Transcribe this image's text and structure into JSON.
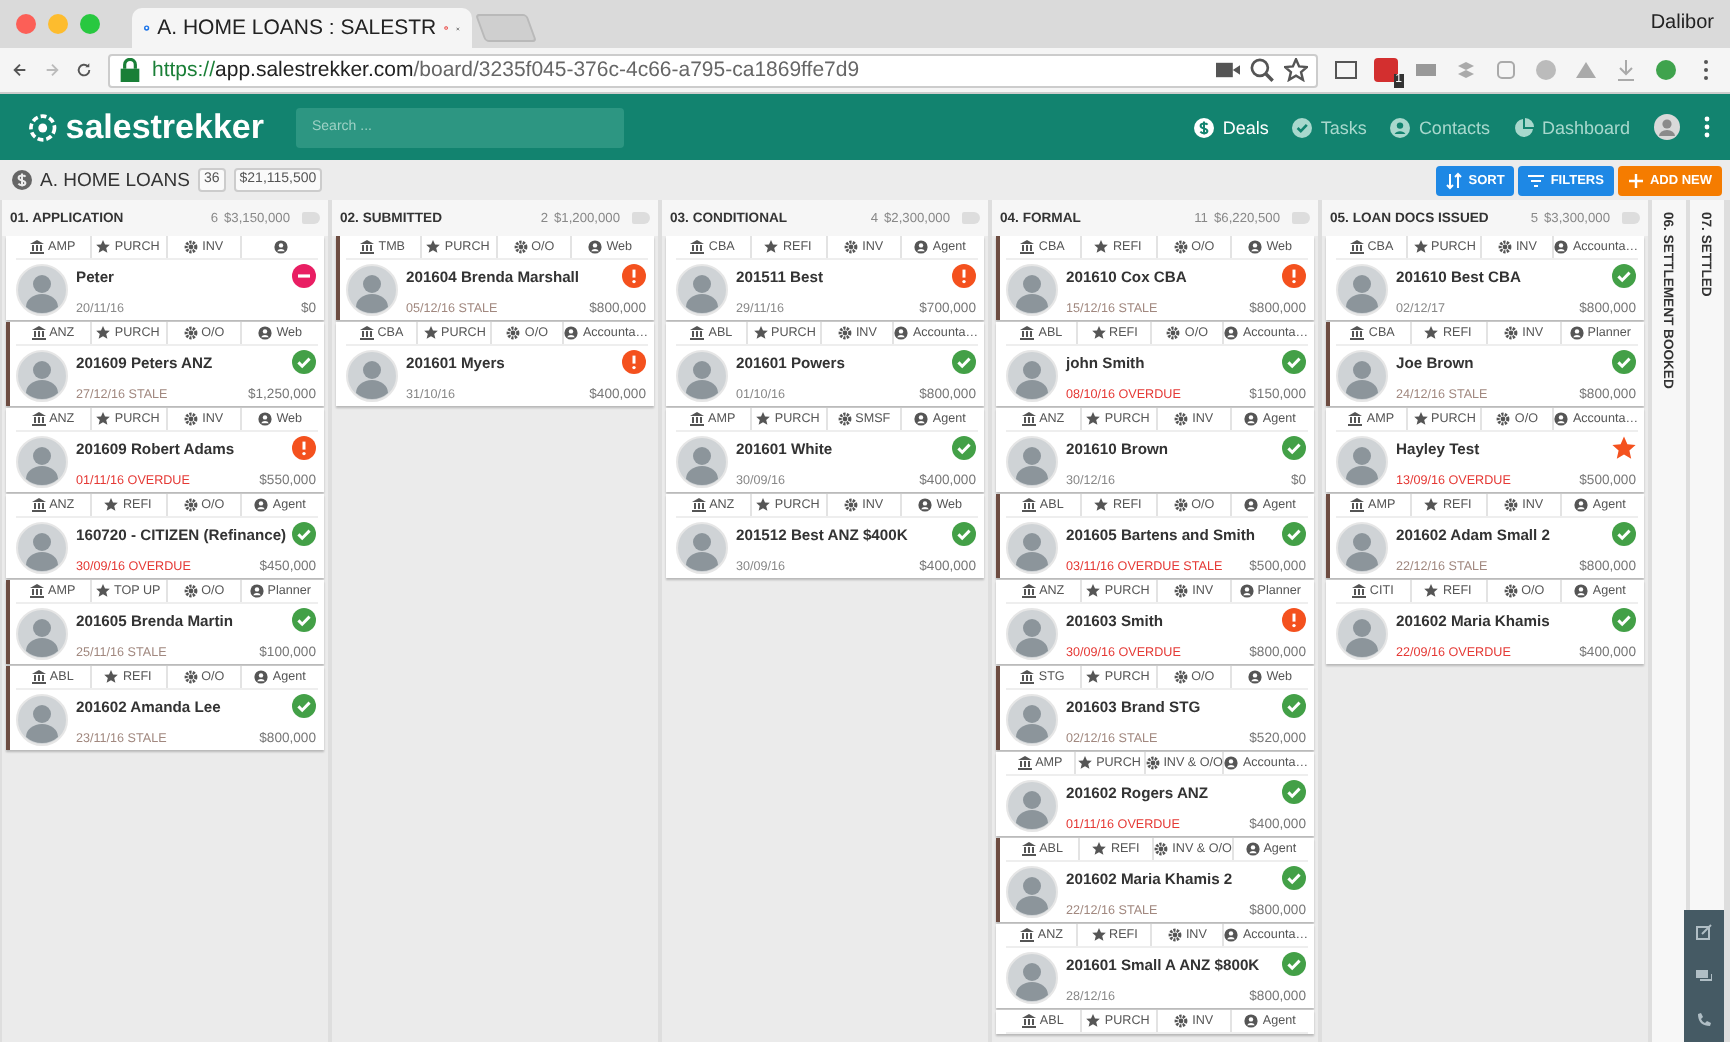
{
  "browser": {
    "tab_title": "A. HOME LOANS : SALESTR",
    "profile": "Dalibor",
    "url": {
      "scheme": "https://",
      "host": "app.salestrekker.com",
      "path": "/board/3235f045-376c-4c66-a795-ca1869ffe7d9"
    },
    "extension_badge": "1"
  },
  "app": {
    "brand": "salestrekker",
    "search": {
      "placeholder": "Search ..."
    },
    "nav": [
      {
        "label": "Deals",
        "kind": "deals",
        "selected": true
      },
      {
        "label": "Tasks",
        "kind": "tasks",
        "selected": false
      },
      {
        "label": "Contacts",
        "kind": "contacts",
        "selected": false
      },
      {
        "label": "Dashboard",
        "kind": "dashboard",
        "selected": false
      }
    ]
  },
  "board": {
    "title": "A. HOME LOANS",
    "count": "36",
    "total": "$21,115,500",
    "buttons": [
      {
        "label": "SORT",
        "kind": "sort"
      },
      {
        "label": "FILTERS",
        "kind": "filter"
      },
      {
        "label": "ADD NEW",
        "kind": "add"
      }
    ]
  },
  "columns": [
    {
      "title": "01. APPLICATION",
      "count": "6",
      "value": "$3,150,000",
      "cards": [
        {
          "tags": {
            "lender": "AMP",
            "type": "PURCH",
            "purpose": "INV"
          },
          "name": "Peter",
          "date": "20/11/16",
          "amount": "$0",
          "kind": "blocked",
          "stale": false,
          "overdue": false
        },
        {
          "tags": {
            "lender": "ANZ",
            "type": "PURCH",
            "purpose": "O/O",
            "source": "Web"
          },
          "name": "201609 Peters ANZ",
          "date": "27/12/16 STALE",
          "amount": "$1,250,000",
          "kind": "done",
          "stale": true,
          "overdue": false
        },
        {
          "tags": {
            "lender": "ANZ",
            "type": "PURCH",
            "purpose": "INV",
            "source": "Web"
          },
          "name": "201609 Robert Adams",
          "date": "01/11/16 OVERDUE",
          "amount": "$550,000",
          "kind": "attention",
          "stale": false,
          "overdue": true
        },
        {
          "tags": {
            "lender": "ANZ",
            "type": "REFI",
            "purpose": "O/O",
            "source": "Agent"
          },
          "name": "160720 - CITIZEN (Refinance)",
          "date": "30/09/16 OVERDUE",
          "amount": "$450,000",
          "kind": "done",
          "stale": false,
          "overdue": true
        },
        {
          "tags": {
            "lender": "AMP",
            "type": "TOP UP",
            "purpose": "O/O",
            "source": "Planner"
          },
          "name": "201605 Brenda Martin",
          "date": "25/11/16 STALE",
          "amount": "$100,000",
          "kind": "done",
          "stale": true,
          "overdue": false
        },
        {
          "tags": {
            "lender": "ABL",
            "type": "REFI",
            "purpose": "O/O",
            "source": "Agent"
          },
          "name": "201602 Amanda Lee",
          "date": "23/11/16 STALE",
          "amount": "$800,000",
          "kind": "done",
          "stale": true,
          "overdue": false
        }
      ]
    },
    {
      "title": "02. SUBMITTED",
      "count": "2",
      "value": "$1,200,000",
      "cards": [
        {
          "tags": {
            "lender": "TMB",
            "type": "PURCH",
            "purpose": "O/O",
            "source": "Web"
          },
          "name": "201604 Brenda Marshall",
          "date": "05/12/16 STALE",
          "amount": "$800,000",
          "kind": "attention",
          "stale": true,
          "overdue": false
        },
        {
          "tags": {
            "lender": "CBA",
            "type": "PURCH",
            "purpose": "O/O",
            "source": "Accounta…"
          },
          "name": "201601 Myers",
          "date": "31/10/16",
          "amount": "$400,000",
          "kind": "attention",
          "stale": false,
          "overdue": false
        }
      ]
    },
    {
      "title": "03. CONDITIONAL",
      "count": "4",
      "value": "$2,300,000",
      "cards": [
        {
          "tags": {
            "lender": "CBA",
            "type": "REFI",
            "purpose": "INV",
            "source": "Agent"
          },
          "name": "201511 Best",
          "date": "29/11/16",
          "amount": "$700,000",
          "kind": "attention",
          "stale": false,
          "overdue": false
        },
        {
          "tags": {
            "lender": "ABL",
            "type": "PURCH",
            "purpose": "INV",
            "source": "Accounta…"
          },
          "name": "201601 Powers",
          "date": "01/10/16",
          "amount": "$800,000",
          "kind": "done",
          "stale": false,
          "overdue": false
        },
        {
          "tags": {
            "lender": "AMP",
            "type": "PURCH",
            "purpose": "SMSF",
            "source": "Agent"
          },
          "name": "201601 White",
          "date": "30/09/16",
          "amount": "$400,000",
          "kind": "done",
          "stale": false,
          "overdue": false
        },
        {
          "tags": {
            "lender": "ANZ",
            "type": "PURCH",
            "purpose": "INV",
            "source": "Web"
          },
          "name": "201512 Best ANZ $400K",
          "date": "30/09/16",
          "amount": "$400,000",
          "kind": "done",
          "stale": false,
          "overdue": false
        }
      ]
    },
    {
      "title": "04. FORMAL",
      "count": "11",
      "value": "$6,220,500",
      "cards": [
        {
          "tags": {
            "lender": "CBA",
            "type": "REFI",
            "purpose": "O/O",
            "source": "Web"
          },
          "name": "201610 Cox CBA",
          "date": "15/12/16 STALE",
          "amount": "$800,000",
          "kind": "attention",
          "stale": true,
          "overdue": false
        },
        {
          "tags": {
            "lender": "ABL",
            "type": "REFI",
            "purpose": "O/O",
            "source": "Accounta…"
          },
          "name": "john Smith",
          "date": "08/10/16 OVERDUE",
          "amount": "$150,000",
          "kind": "done",
          "stale": false,
          "overdue": true
        },
        {
          "tags": {
            "lender": "ANZ",
            "type": "PURCH",
            "purpose": "INV",
            "source": "Agent"
          },
          "name": "201610 Brown",
          "date": "30/12/16",
          "amount": "$0",
          "kind": "done",
          "stale": false,
          "overdue": false
        },
        {
          "tags": {
            "lender": "ABL",
            "type": "REFI",
            "purpose": "O/O",
            "source": "Agent"
          },
          "name": "201605 Bartens and Smith",
          "date": "03/11/16 OVERDUE STALE",
          "amount": "$500,000",
          "kind": "done",
          "stale": true,
          "overdue": true
        },
        {
          "tags": {
            "lender": "ANZ",
            "type": "PURCH",
            "purpose": "INV",
            "source": "Planner"
          },
          "name": "201603 Smith",
          "date": "30/09/16 OVERDUE",
          "amount": "$800,000",
          "kind": "attention",
          "stale": false,
          "overdue": true
        },
        {
          "tags": {
            "lender": "STG",
            "type": "PURCH",
            "purpose": "O/O",
            "source": "Web"
          },
          "name": "201603 Brand STG",
          "date": "02/12/16 STALE",
          "amount": "$520,000",
          "kind": "done",
          "stale": true,
          "overdue": false
        },
        {
          "tags": {
            "lender": "AMP",
            "type": "PURCH",
            "purpose": "INV & O/O",
            "source": "Accounta…"
          },
          "name": "201602 Rogers ANZ",
          "date": "01/11/16 OVERDUE",
          "amount": "$400,000",
          "kind": "done",
          "stale": false,
          "overdue": true
        },
        {
          "tags": {
            "lender": "ABL",
            "type": "REFI",
            "purpose": "INV & O/O",
            "source": "Agent"
          },
          "name": "201602 Maria Khamis 2",
          "date": "22/12/16 STALE",
          "amount": "$800,000",
          "kind": "done",
          "stale": true,
          "overdue": false
        },
        {
          "tags": {
            "lender": "ANZ",
            "type": "REFI",
            "purpose": "INV",
            "source": "Accounta…"
          },
          "name": "201601 Small A ANZ $800K",
          "date": "28/12/16",
          "amount": "$800,000",
          "kind": "done",
          "stale": false,
          "overdue": false
        },
        {
          "tags": {
            "lender": "ABL",
            "type": "PURCH",
            "purpose": "INV",
            "source": "Agent"
          }
        }
      ]
    },
    {
      "title": "05. LOAN DOCS ISSUED",
      "count": "5",
      "value": "$3,300,000",
      "cards": [
        {
          "tags": {
            "lender": "CBA",
            "type": "PURCH",
            "purpose": "INV",
            "source": "Accounta…"
          },
          "name": "201610 Best CBA",
          "date": "02/12/17",
          "amount": "$800,000",
          "kind": "done",
          "stale": false,
          "overdue": false
        },
        {
          "tags": {
            "lender": "CBA",
            "type": "REFI",
            "purpose": "INV",
            "source": "Planner"
          },
          "name": "Joe Brown",
          "date": "24/12/16 STALE",
          "amount": "$800,000",
          "kind": "done",
          "stale": true,
          "overdue": false
        },
        {
          "tags": {
            "lender": "AMP",
            "type": "PURCH",
            "purpose": "O/O",
            "source": "Accounta…"
          },
          "name": "Hayley Test",
          "date": "13/09/16 OVERDUE",
          "amount": "$500,000",
          "kind": "starred",
          "stale": false,
          "overdue": true
        },
        {
          "tags": {
            "lender": "AMP",
            "type": "REFI",
            "purpose": "INV",
            "source": "Agent"
          },
          "name": "201602 Adam Small 2",
          "date": "22/12/16 STALE",
          "amount": "$800,000",
          "kind": "done",
          "stale": true,
          "overdue": false
        },
        {
          "tags": {
            "lender": "CITI",
            "type": "REFI",
            "purpose": "O/O",
            "source": "Agent"
          },
          "name": "201602 Maria Khamis",
          "date": "22/09/16 OVERDUE",
          "amount": "$400,000",
          "kind": "done",
          "stale": false,
          "overdue": true
        }
      ]
    }
  ],
  "collapsed_columns": [
    {
      "title": "06. SETTLEMENT BOOKED"
    },
    {
      "title": "07. SETTLED"
    }
  ]
}
